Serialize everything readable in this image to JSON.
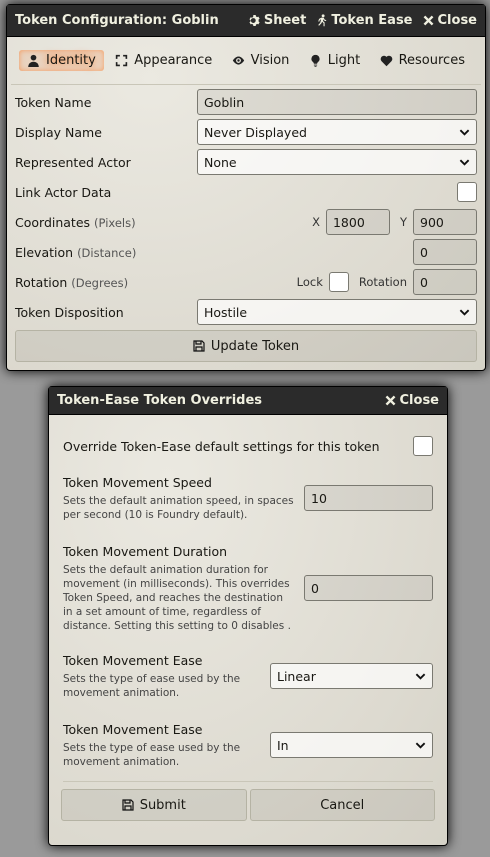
{
  "token_config": {
    "title": "Token Configuration: Goblin",
    "header_buttons": {
      "sheet": "Sheet",
      "token_ease": "Token Ease",
      "close": "Close"
    },
    "tabs": [
      {
        "label": "Identity",
        "icon": "user-icon",
        "active": true
      },
      {
        "label": "Appearance",
        "icon": "expand-icon"
      },
      {
        "label": "Vision",
        "icon": "eye-icon"
      },
      {
        "label": "Light",
        "icon": "lightbulb-icon"
      },
      {
        "label": "Resources",
        "icon": "heart-icon"
      }
    ],
    "fields": {
      "token_name": {
        "label": "Token Name",
        "value": "Goblin"
      },
      "display_name": {
        "label": "Display Name",
        "value": "Never Displayed"
      },
      "represented_actor": {
        "label": "Represented Actor",
        "value": "None"
      },
      "link_actor_data": {
        "label": "Link Actor Data"
      },
      "coordinates": {
        "label": "Coordinates",
        "hint": "(Pixels)",
        "x_label": "X",
        "x": "1800",
        "y_label": "Y",
        "y": "900"
      },
      "elevation": {
        "label": "Elevation",
        "hint": "(Distance)",
        "value": "0"
      },
      "rotation": {
        "label": "Rotation",
        "hint": "(Degrees)",
        "lock_label": "Lock",
        "rotation_label": "Rotation",
        "value": "0"
      },
      "token_disposition": {
        "label": "Token Disposition",
        "value": "Hostile"
      }
    },
    "update_button": "Update Token"
  },
  "overrides": {
    "title": "Token-Ease Token Overrides",
    "close": "Close",
    "override_label": "Override Token-Ease default settings for this token",
    "speed": {
      "title": "Token Movement Speed",
      "desc": "Sets the default animation speed, in spaces per second (10 is Foundry default).",
      "value": "10"
    },
    "duration": {
      "title": "Token Movement Duration",
      "desc": "Sets the default animation duration for movement (in milliseconds). This overrides Token Speed, and reaches the destination in a set amount of time, regardless of distance. Setting this setting to 0 disables .",
      "value": "0"
    },
    "ease1": {
      "title": "Token Movement Ease",
      "desc": "Sets the type of ease used by the movement animation.",
      "value": "Linear"
    },
    "ease2": {
      "title": "Token Movement Ease",
      "desc": "Sets the type of ease used by the movement animation.",
      "value": "In"
    },
    "submit": "Submit",
    "cancel": "Cancel"
  },
  "colors": {
    "header": "#2b2b2b",
    "active_tab_glow": "#ff6400"
  }
}
